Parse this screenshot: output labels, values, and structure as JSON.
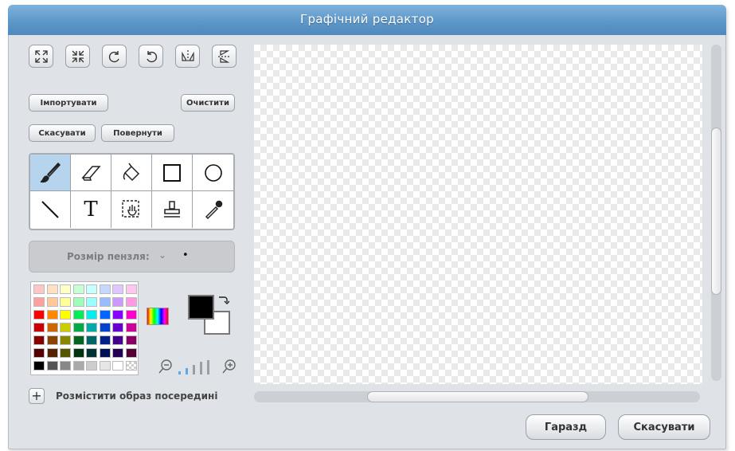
{
  "window": {
    "title": "Графічний редактор"
  },
  "toolbar": {
    "icons": [
      "expand-icon",
      "shrink-icon",
      "rotate-left-icon",
      "rotate-right-icon",
      "flip-horizontal-icon",
      "flip-vertical-icon"
    ]
  },
  "buttons": {
    "import": "Імпортувати",
    "clear": "Очистити",
    "undo": "Скасувати",
    "redo": "Повернути"
  },
  "tools": [
    "paintbrush-icon",
    "eraser-icon",
    "fill-bucket-icon",
    "rectangle-icon",
    "ellipse-icon",
    "line-icon",
    "text-icon",
    "select-icon",
    "stamp-icon",
    "eyedropper-icon"
  ],
  "brush": {
    "label": "Розмір пензля:",
    "chevron": "⌄",
    "dot": "•"
  },
  "colors": {
    "foreground": "#000000",
    "background": "#ffffff",
    "palette": [
      [
        "#ffc6c6",
        "#ffe0c2",
        "#ffffc6",
        "#c6ffd6",
        "#c6ffff",
        "#c6d8ff",
        "#e0c6ff",
        "#ffc6ef"
      ],
      [
        "#ff9f9f",
        "#ffc999",
        "#ffff99",
        "#99ffbb",
        "#99ffff",
        "#99bbff",
        "#cc99ff",
        "#ff99e6"
      ],
      [
        "#ff0000",
        "#ff8800",
        "#ffff00",
        "#00ee55",
        "#00eeee",
        "#0066ff",
        "#8800ff",
        "#ff00cc"
      ],
      [
        "#cc0000",
        "#cc6600",
        "#cccc00",
        "#00aa44",
        "#00aaaa",
        "#0044cc",
        "#6600cc",
        "#cc0099"
      ],
      [
        "#880000",
        "#884400",
        "#888800",
        "#006622",
        "#006666",
        "#002288",
        "#440088",
        "#880066"
      ],
      [
        "#550000",
        "#552200",
        "#555500",
        "#003311",
        "#003333",
        "#001155",
        "#220055",
        "#550033"
      ],
      [
        "#000000",
        "#555555",
        "#888888",
        "#aaaaaa",
        "#cccccc",
        "#e6e6e6",
        "#ffffff",
        "checker"
      ]
    ]
  },
  "center_image": {
    "label": "Розмістити образ посередині",
    "plus": "+"
  },
  "dialog": {
    "ok": "Гаразд",
    "cancel": "Скасувати"
  }
}
